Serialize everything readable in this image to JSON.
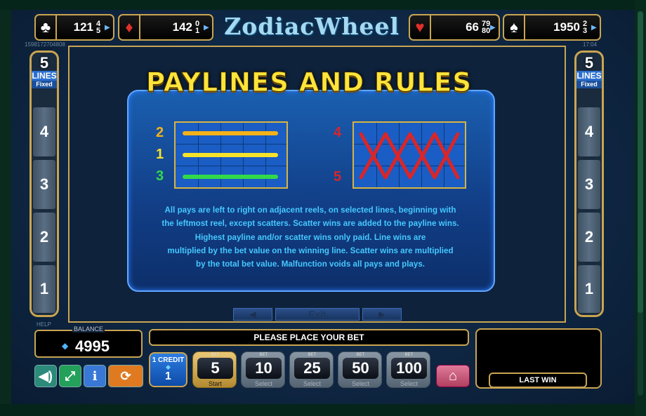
{
  "game_title": "ZodiacWheel",
  "session_id": "1598172704808",
  "clock": "17:04",
  "jackpots": [
    {
      "suit": "clubs",
      "symbol": "♣",
      "value": "121",
      "digit_top": "4",
      "digit_bottom": "5"
    },
    {
      "suit": "diamonds",
      "symbol": "♦",
      "value": "142",
      "digit_top": "0",
      "digit_bottom": "1"
    },
    {
      "suit": "hearts",
      "symbol": "♥",
      "value": "66",
      "digit_top": "79",
      "digit_bottom": "80"
    },
    {
      "suit": "spades",
      "symbol": "♠",
      "value": "1950",
      "digit_top": "2",
      "digit_bottom": "3"
    }
  ],
  "lines_panel": {
    "count": "5",
    "lines_label": "LINES",
    "fixed_label": "Fixed",
    "numbers": [
      "4",
      "3",
      "2",
      "1"
    ]
  },
  "rules": {
    "title": "PAYLINES AND RULES",
    "left_lines": [
      "2",
      "1",
      "3"
    ],
    "right_lines": [
      "4",
      "5"
    ],
    "text_lines": [
      "All pays are left to right on adjacent reels, on selected lines, beginning with",
      "the leftmost reel, except scatters. Scatter wins are added to the payline wins.",
      "Highest payline and/or scatter  wins only paid. Line wins are",
      "multiplied by the bet value on the winning line. Scatter wins are multiplied",
      "by the total bet value. Malfunction voids all pays and plays."
    ],
    "exit_label": "Exit"
  },
  "footer": {
    "help_label": "HELP",
    "balance_label": "BALANCE",
    "balance_value": "4995",
    "message": "PLEASE PLACE YOUR BET",
    "last_win_label": "LAST WIN",
    "credit_label": "1 CREDIT",
    "credit_value": "1",
    "bet_tag": "BET",
    "bets": [
      {
        "value": "5",
        "sub": "Start",
        "selected": true
      },
      {
        "value": "10",
        "sub": "Select",
        "selected": false
      },
      {
        "value": "25",
        "sub": "Select",
        "selected": false
      },
      {
        "value": "50",
        "sub": "Select",
        "selected": false
      },
      {
        "value": "100",
        "sub": "Select",
        "selected": false
      }
    ],
    "controls": [
      {
        "name": "sound-icon",
        "glyph": "🔊",
        "color": "#2b8a7a"
      },
      {
        "name": "fullscreen-icon",
        "glyph": "⤢",
        "color": "#23a05a"
      },
      {
        "name": "info-icon",
        "glyph": "i",
        "color": "#3a78d8"
      },
      {
        "name": "autoplay-icon",
        "glyph": "⟳",
        "color": "#e07a20"
      }
    ]
  },
  "colors": {
    "gold": "#c9a552",
    "title_yellow": "#ffe43a",
    "rule_text": "#45c8ff",
    "line_orange": "#f5b21a",
    "line_yellow": "#f7e22a",
    "line_green": "#32d94a",
    "line_red": "#d8262a"
  }
}
